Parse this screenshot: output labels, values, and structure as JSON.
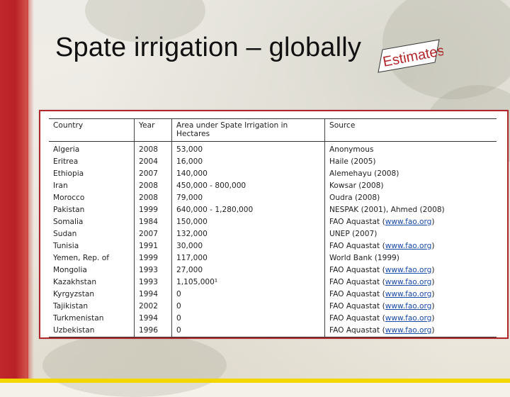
{
  "slide": {
    "title": "Spate irrigation – globally",
    "stamp_text": "Estimates"
  },
  "table": {
    "headers": {
      "country": "Country",
      "year": "Year",
      "area": "Area under Spate Irrigation in Hectares",
      "source": "Source"
    },
    "rows": [
      {
        "country": "Algeria",
        "year": "2008",
        "area": "53,000",
        "source_pre": "Anonymous",
        "source_link": "",
        "source_post": ""
      },
      {
        "country": "Eritrea",
        "year": "2004",
        "area": "16,000",
        "source_pre": "Haile (2005)",
        "source_link": "",
        "source_post": ""
      },
      {
        "country": "Ethiopia",
        "year": "2007",
        "area": "140,000",
        "source_pre": "Alemehayu (2008)",
        "source_link": "",
        "source_post": ""
      },
      {
        "country": "Iran",
        "year": "2008",
        "area": "450,000 - 800,000",
        "source_pre": "Kowsar (2008)",
        "source_link": "",
        "source_post": ""
      },
      {
        "country": "Morocco",
        "year": "2008",
        "area": "79,000",
        "source_pre": "Oudra (2008)",
        "source_link": "",
        "source_post": ""
      },
      {
        "country": "Pakistan",
        "year": "1999",
        "area": "640,000 - 1,280,000",
        "source_pre": "NESPAK (2001), Ahmed (2008)",
        "source_link": "",
        "source_post": ""
      },
      {
        "country": "Somalia",
        "year": "1984",
        "area": "150,000",
        "source_pre": "FAO Aquastat (",
        "source_link": "www.fao.org",
        "source_post": ")"
      },
      {
        "country": "Sudan",
        "year": "2007",
        "area": "132,000",
        "source_pre": "UNEP (2007)",
        "source_link": "",
        "source_post": ""
      },
      {
        "country": "Tunisia",
        "year": "1991",
        "area": "30,000",
        "source_pre": "FAO Aquastat (",
        "source_link": "www.fao.org",
        "source_post": ")"
      },
      {
        "country": "Yemen, Rep. of",
        "year": "1999",
        "area": "117,000",
        "source_pre": "World Bank (1999)",
        "source_link": "",
        "source_post": ""
      },
      {
        "country": "Mongolia",
        "year": "1993",
        "area": "27,000",
        "source_pre": "FAO Aquastat (",
        "source_link": "www.fao.org",
        "source_post": ")"
      },
      {
        "country": "Kazakhstan",
        "year": "1993",
        "area": "1,105,000¹",
        "source_pre": "FAO Aquastat (",
        "source_link": "www.fao.org",
        "source_post": ")"
      },
      {
        "country": "Kyrgyzstan",
        "year": "1994",
        "area": "0",
        "source_pre": "FAO Aquastat (",
        "source_link": "www.fao.org",
        "source_post": ")"
      },
      {
        "country": "Tajikistan",
        "year": "2002",
        "area": "0",
        "source_pre": "FAO Aquastat (",
        "source_link": "www.fao.org",
        "source_post": ")"
      },
      {
        "country": "Turkmenistan",
        "year": "1994",
        "area": "0",
        "source_pre": "FAO Aquastat (",
        "source_link": "www.fao.org",
        "source_post": ")"
      },
      {
        "country": "Uzbekistan",
        "year": "1996",
        "area": "0",
        "source_pre": "FAO Aquastat (",
        "source_link": "www.fao.org",
        "source_post": ")"
      }
    ]
  },
  "colors": {
    "accent_red": "#c0272d",
    "accent_yellow": "#f2d600",
    "link_blue": "#1a4aa8"
  }
}
